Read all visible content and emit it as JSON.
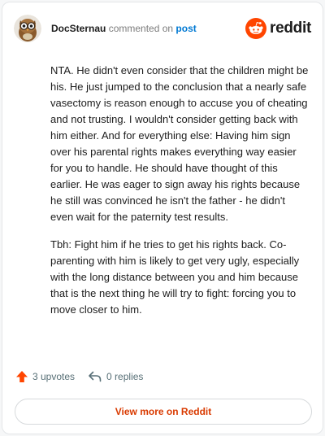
{
  "comment": {
    "username": "DocSternau",
    "action_text": " commented on ",
    "post_link": "post",
    "paragraphs": [
      "NTA. He didn't even consider that the children might be his. He just jumped to the conclusion that a nearly safe vasectomy is reason enough to accuse you of cheating and not trusting. I wouldn't consider getting back with him either. And for everything else: Having him sign over his parental rights makes everything way easier for you to handle. He should have thought of this earlier. He was eager to sign away his rights because he still was convinced he isn't the father - he didn't even wait for the paternity test results.",
      "Tbh: Fight him if he tries to get his rights back. Co-parenting with him is likely to get very ugly, especially with the long distance between you and him because that is the next thing he will try to fight: forcing you to move closer to him."
    ]
  },
  "brand": {
    "wordmark": "reddit",
    "color": "#ff4500"
  },
  "actions": {
    "upvotes": "3 upvotes",
    "replies": "0 replies"
  },
  "footer": {
    "view_more": "View more on Reddit"
  },
  "colors": {
    "accent": "#d93a00",
    "link": "#0079d3",
    "upvote": "#ff4500"
  }
}
